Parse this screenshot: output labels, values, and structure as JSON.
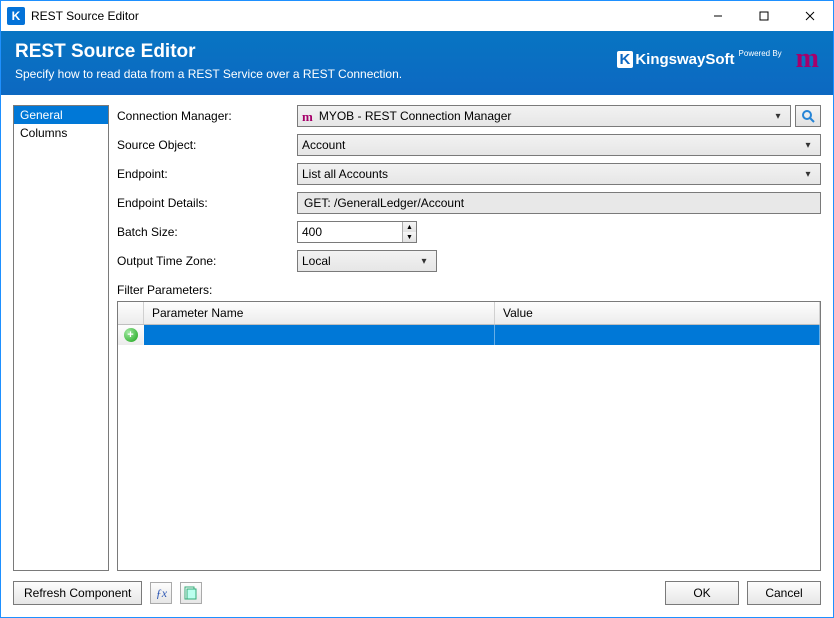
{
  "window": {
    "title": "REST Source Editor"
  },
  "header": {
    "title": "REST Source Editor",
    "subtitle": "Specify how to read data from a REST Service over a REST Connection.",
    "brand1": "KingswaySoft",
    "brand1_tag": "Powered By"
  },
  "nav": {
    "items": [
      {
        "label": "General",
        "selected": true
      },
      {
        "label": "Columns",
        "selected": false
      }
    ]
  },
  "form": {
    "connection_label": "Connection Manager:",
    "connection_value": "MYOB - REST Connection Manager",
    "source_object_label": "Source Object:",
    "source_object_value": "Account",
    "endpoint_label": "Endpoint:",
    "endpoint_value": "List all Accounts",
    "endpoint_details_label": "Endpoint Details:",
    "endpoint_details_value": "GET: /GeneralLedger/Account",
    "batch_size_label": "Batch Size:",
    "batch_size_value": "400",
    "output_tz_label": "Output Time Zone:",
    "output_tz_value": "Local",
    "filter_label": "Filter Parameters:"
  },
  "grid": {
    "col_param": "Parameter Name",
    "col_value": "Value"
  },
  "footer": {
    "refresh": "Refresh Component",
    "ok": "OK",
    "cancel": "Cancel"
  }
}
